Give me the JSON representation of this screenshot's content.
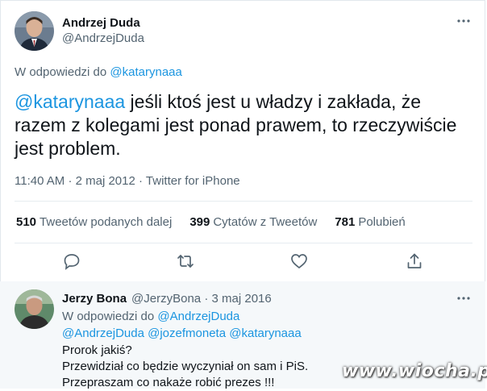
{
  "tweet": {
    "author_name": "Andrzej Duda",
    "author_handle": "@AndrzejDuda",
    "reply_prefix": "W odpowiedzi do",
    "reply_to": "@katarynaaa",
    "text_mention": "@katarynaaa",
    "text_body": " jeśli ktoś jest u władzy i zakłada, że razem z kolegami jest ponad prawem, to rzeczywiście jest problem.",
    "time": "11:40 AM",
    "date": "2 maj 2012",
    "source": "Twitter for iPhone",
    "separator": "·"
  },
  "stats": {
    "retweets_count": "510",
    "retweets_label": "Tweetów podanych dalej",
    "quotes_count": "399",
    "quotes_label": "Cytatów z Tweetów",
    "likes_count": "781",
    "likes_label": "Polubień"
  },
  "actions": [
    "reply-icon",
    "retweet-icon",
    "like-icon",
    "share-icon"
  ],
  "reply": {
    "author_name": "Jerzy Bona",
    "author_handle": "@JerzyBona",
    "separator": "·",
    "date": "3 maj 2016",
    "reply_prefix": "W odpowiedzi do",
    "reply_to": "@AndrzejDuda",
    "mentions": [
      "@AndrzejDuda",
      "@jozefmoneta",
      "@katarynaaa"
    ],
    "lines": [
      "Prorok jakiś?",
      "Przewidział co będzie wyczyniał on sam i PiS.",
      "Przepraszam co nakaże robić prezes !!!"
    ]
  },
  "watermark": "www.wiocha.pl",
  "colors": {
    "link": "#1b95e0",
    "muted": "#536471",
    "reply_bg": "#f5f8fa"
  }
}
